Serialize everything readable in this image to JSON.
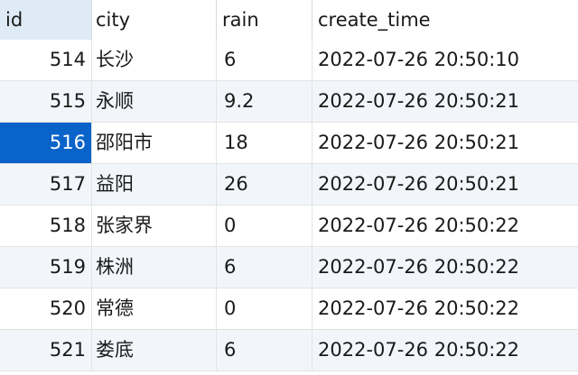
{
  "table": {
    "columns": [
      "id",
      "city",
      "rain",
      "create_time"
    ],
    "rows": [
      {
        "id": "514",
        "city": "长沙",
        "rain": "6",
        "create_time": "2022-07-26 20:50:10"
      },
      {
        "id": "515",
        "city": "永顺",
        "rain": "9.2",
        "create_time": "2022-07-26 20:50:21"
      },
      {
        "id": "516",
        "city": "邵阳市",
        "rain": "18",
        "create_time": "2022-07-26 20:50:21"
      },
      {
        "id": "517",
        "city": "益阳",
        "rain": "26",
        "create_time": "2022-07-26 20:50:21"
      },
      {
        "id": "518",
        "city": "张家界",
        "rain": "0",
        "create_time": "2022-07-26 20:50:22"
      },
      {
        "id": "519",
        "city": "株洲",
        "rain": "6",
        "create_time": "2022-07-26 20:50:22"
      },
      {
        "id": "520",
        "city": "常德",
        "rain": "0",
        "create_time": "2022-07-26 20:50:22"
      },
      {
        "id": "521",
        "city": "娄底",
        "rain": "6",
        "create_time": "2022-07-26 20:50:22"
      }
    ],
    "selected_row_index": 2,
    "colors": {
      "header_sorted_bg": "#dfeaf7",
      "alt_row_bg": "#f2f6fb",
      "selection_bg": "#0a63c9",
      "grid_line": "#e3e3e3"
    }
  }
}
